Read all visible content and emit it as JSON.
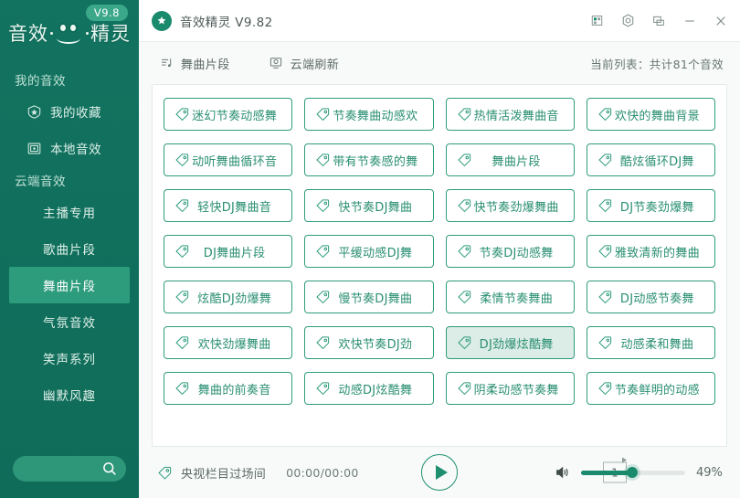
{
  "sidebar": {
    "logo_text": "音效",
    "logo_text2": "精灵",
    "version_badge": "V9.8",
    "search_placeholder": "",
    "search_value": "",
    "search_icon": "search-icon",
    "sections": [
      {
        "title": "我的音效",
        "items": [
          {
            "label": "我的收藏",
            "icon": "star-badge-icon",
            "active": false
          },
          {
            "label": "本地音效",
            "icon": "folder-window-icon",
            "active": false
          }
        ]
      },
      {
        "title": "云端音效",
        "items": [
          {
            "label": "主播专用",
            "active": false
          },
          {
            "label": "歌曲片段",
            "active": false
          },
          {
            "label": "舞曲片段",
            "active": true
          },
          {
            "label": "气氛音效",
            "active": false
          },
          {
            "label": "笑声系列",
            "active": false
          },
          {
            "label": "幽默风趣",
            "active": false
          }
        ]
      }
    ]
  },
  "titlebar": {
    "app_icon": "app-star-icon",
    "title": "音效精灵 V9.82",
    "buttons": [
      {
        "name": "layout-icon",
        "glyph": "layout"
      },
      {
        "name": "settings-gear-icon",
        "glyph": "hex"
      },
      {
        "name": "restore-window-icon",
        "glyph": "restore"
      },
      {
        "name": "minimize-icon",
        "glyph": "minimize"
      },
      {
        "name": "close-icon",
        "glyph": "close"
      }
    ]
  },
  "toolbar": {
    "tabs": [
      {
        "label": "舞曲片段",
        "icon": "playlist-music-icon"
      },
      {
        "label": "云端刷新",
        "icon": "cloud-refresh-icon"
      }
    ],
    "count_text": "当前列表：共计81个音效"
  },
  "grid": {
    "items": [
      {
        "label": "迷幻节奏动感舞",
        "selected": false
      },
      {
        "label": "节奏舞曲动感欢",
        "selected": false
      },
      {
        "label": "热情活泼舞曲音",
        "selected": false
      },
      {
        "label": "欢快的舞曲背景",
        "selected": false
      },
      {
        "label": "动听舞曲循环音",
        "selected": false
      },
      {
        "label": "带有节奏感的舞",
        "selected": false
      },
      {
        "label": "舞曲片段",
        "selected": false
      },
      {
        "label": "酷炫循环DJ舞",
        "selected": false
      },
      {
        "label": "轻快DJ舞曲音",
        "selected": false
      },
      {
        "label": "快节奏DJ舞曲",
        "selected": false
      },
      {
        "label": "快节奏劲爆舞曲",
        "selected": false
      },
      {
        "label": "DJ节奏劲爆舞",
        "selected": false
      },
      {
        "label": "DJ舞曲片段",
        "selected": false
      },
      {
        "label": "平缓动感DJ舞",
        "selected": false
      },
      {
        "label": "节奏DJ动感舞",
        "selected": false
      },
      {
        "label": "雅致清新的舞曲",
        "selected": false
      },
      {
        "label": "炫酷DJ劲爆舞",
        "selected": false
      },
      {
        "label": "慢节奏DJ舞曲",
        "selected": false
      },
      {
        "label": "柔情节奏舞曲",
        "selected": false
      },
      {
        "label": "DJ动感节奏舞",
        "selected": false
      },
      {
        "label": "欢快劲爆舞曲",
        "selected": false
      },
      {
        "label": "欢快节奏DJ劲",
        "selected": false
      },
      {
        "label": "DJ劲爆炫酷舞",
        "selected": true
      },
      {
        "label": "动感柔和舞曲",
        "selected": false
      },
      {
        "label": "舞曲的前奏音",
        "selected": false
      },
      {
        "label": "动感DJ炫酷舞",
        "selected": false
      },
      {
        "label": "阴柔动感节奏舞",
        "selected": false
      },
      {
        "label": "节奏鲜明的动感",
        "selected": false
      }
    ]
  },
  "player": {
    "now_playing_icon": "tag-music-icon",
    "now_playing": "央视栏目过场间",
    "time": "00:00/00:00",
    "play_icon": "play-icon",
    "loop_label": "1",
    "loop_icon": "repeat-one-icon",
    "volume_icon": "speaker-icon",
    "volume_percent": "49%",
    "volume_value": 49
  },
  "colors": {
    "sidebar_bg": "#12765f",
    "accent": "#2f9c7d",
    "active_nav": "#2d9c7c",
    "selected_tile": "#dcece6",
    "panel_bg": "#ffffff",
    "page_bg": "#f7faf9"
  }
}
